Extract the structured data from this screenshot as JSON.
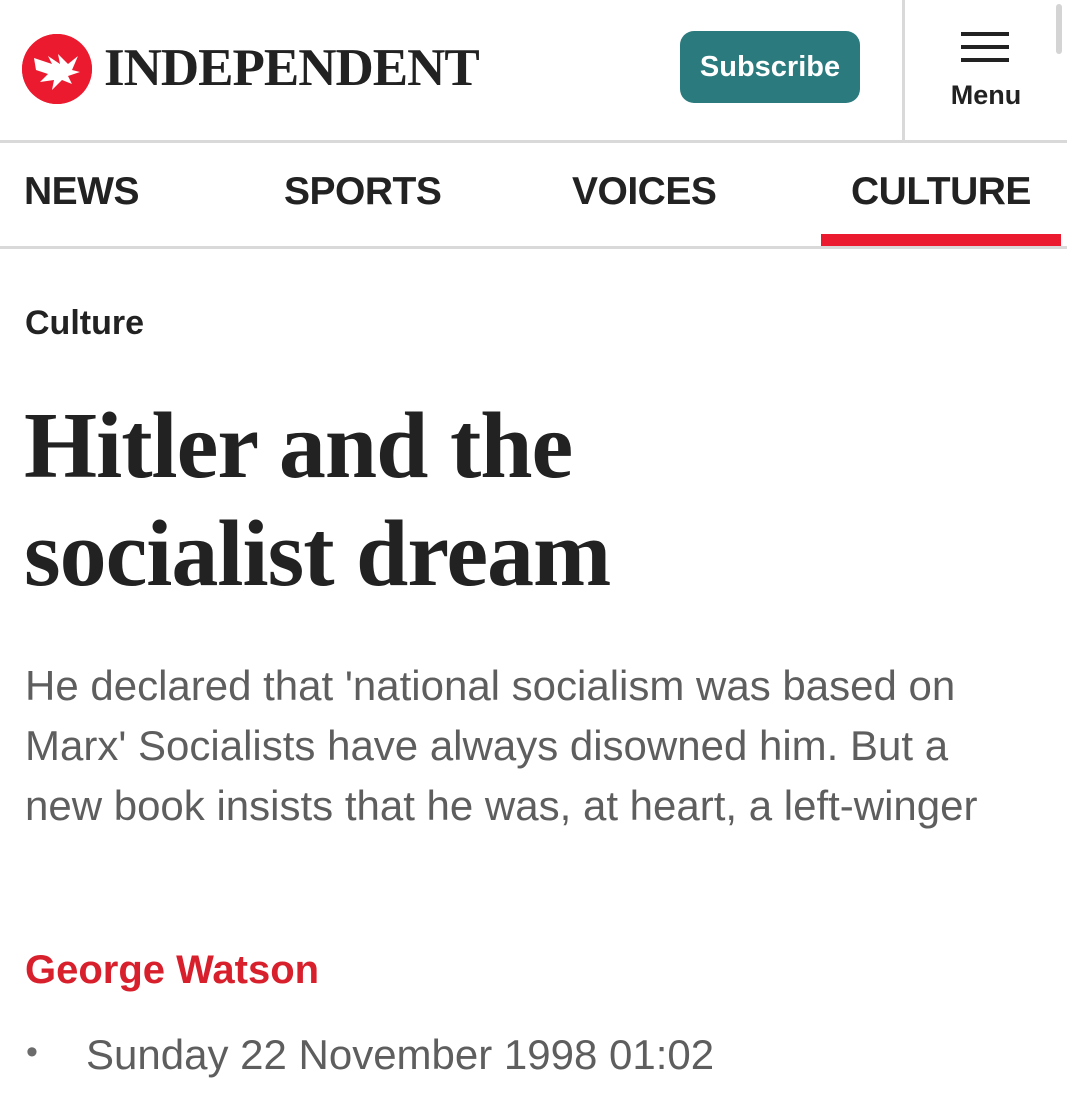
{
  "header": {
    "logo_icon": "eagle-logo-icon",
    "brand_color": "#ec1a2e",
    "wordmark": "INDEPENDENT",
    "subscribe_label": "Subscribe",
    "subscribe_color": "#2b7a7e",
    "menu_icon": "hamburger-icon",
    "menu_label": "Menu"
  },
  "nav": {
    "tabs": [
      {
        "label": "NEWS",
        "active": false
      },
      {
        "label": "SPORTS",
        "active": false
      },
      {
        "label": "VOICES",
        "active": false
      },
      {
        "label": "CULTURE",
        "active": true
      }
    ],
    "active_color": "#ec1a2e"
  },
  "article": {
    "section": "Culture",
    "headline_line1": "Hitler and the",
    "headline_line2": "socialist dream",
    "standfirst": "He declared that 'national socialism was based on Marx' Socialists have always disowned him. But a new book insists that he was, at heart, a left-winger",
    "author": "George Watson",
    "author_color": "#d8202d",
    "date": "Sunday 22 November 1998 01:02"
  }
}
